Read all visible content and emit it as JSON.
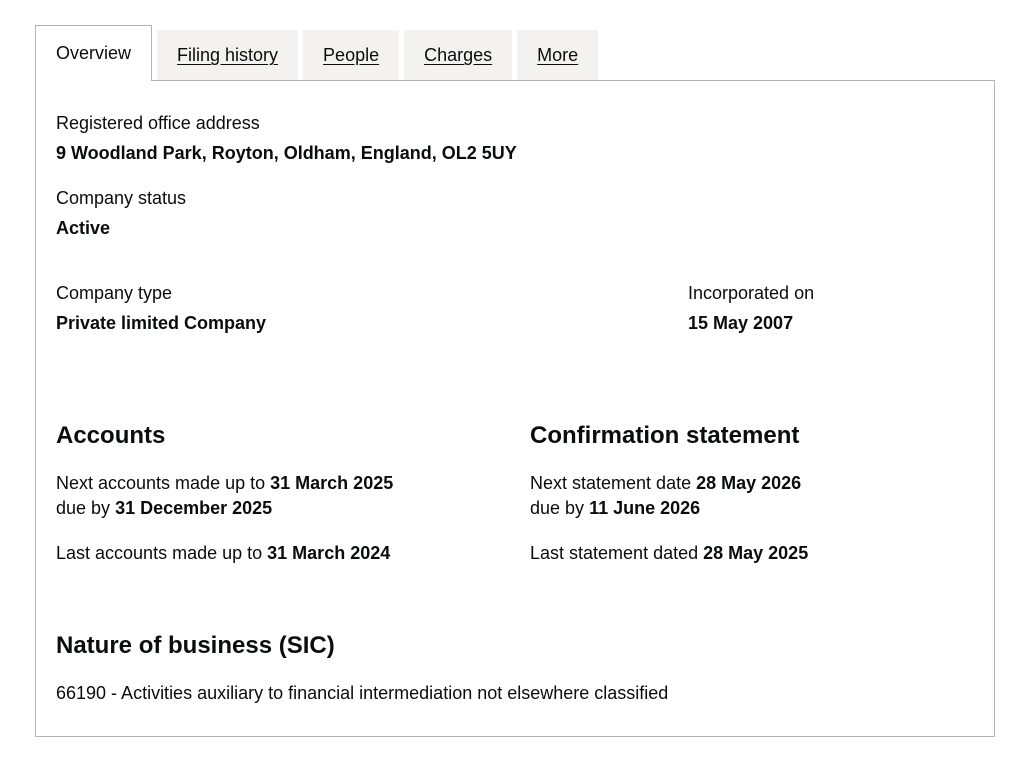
{
  "tabs": [
    {
      "label": "Overview",
      "active": true
    },
    {
      "label": "Filing history",
      "active": false
    },
    {
      "label": "People",
      "active": false
    },
    {
      "label": "Charges",
      "active": false
    },
    {
      "label": "More",
      "active": false
    }
  ],
  "registered_office": {
    "label": "Registered office address",
    "value": "9 Woodland Park, Royton, Oldham, England, OL2 5UY"
  },
  "company_status": {
    "label": "Company status",
    "value": "Active"
  },
  "company_type": {
    "label": "Company type",
    "value": "Private limited Company"
  },
  "incorporated": {
    "label": "Incorporated on",
    "value": "15 May 2007"
  },
  "accounts": {
    "heading": "Accounts",
    "next_label": "Next accounts made up to",
    "next_value": "31 March 2025",
    "due_label": "due by",
    "due_value": "31 December 2025",
    "last_label": "Last accounts made up to",
    "last_value": "31 March 2024"
  },
  "confirmation": {
    "heading": "Confirmation statement",
    "next_label": "Next statement date",
    "next_value": "28 May 2026",
    "due_label": "due by",
    "due_value": "11 June 2026",
    "last_label": "Last statement dated",
    "last_value": "28 May 2025"
  },
  "nature_of_business": {
    "heading": "Nature of business (SIC)",
    "items": [
      "66190 - Activities auxiliary to financial intermediation not elsewhere classified"
    ]
  }
}
